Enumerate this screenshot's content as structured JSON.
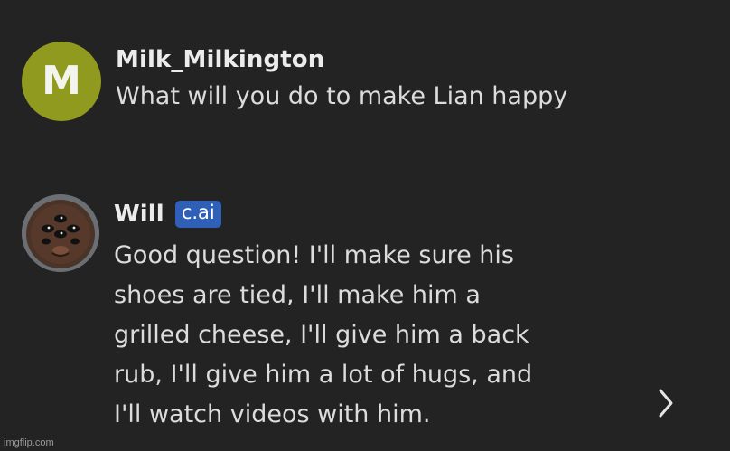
{
  "messages": [
    {
      "author": "Milk_Milkington",
      "avatar_letter": "M",
      "text": "What will you do to make Lian happy"
    },
    {
      "author": "Will",
      "badge": "c.ai",
      "lines": [
        "Good question! I'll make sure his",
        "shoes are tied, I'll make him a",
        "grilled cheese, I'll give him a back",
        "rub, I'll give him a lot of hugs, and",
        "I'll watch videos with him."
      ]
    }
  ],
  "icons": {
    "next": "chevron-right-icon"
  },
  "colors": {
    "background": "#232323",
    "user_avatar": "#8f9a1f",
    "badge": "#2f5fb6"
  },
  "watermark": "imgflip.com"
}
